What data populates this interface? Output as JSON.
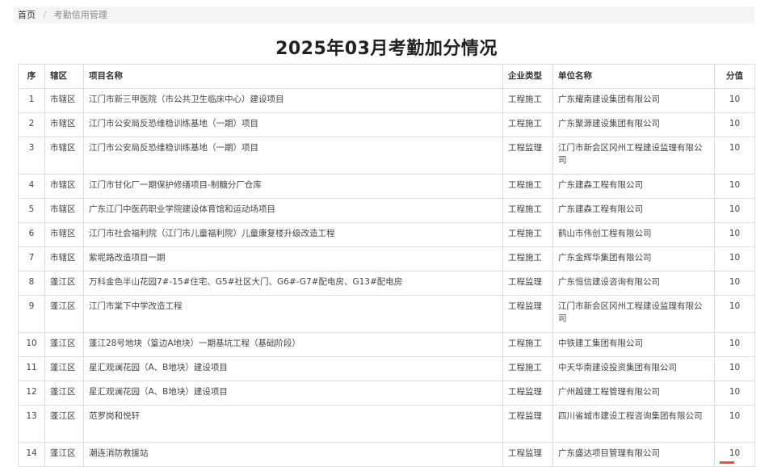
{
  "breadcrumb": {
    "home": "首页",
    "separator": "/",
    "current": "考勤信用管理"
  },
  "page_title": "2025年03月考勤加分情况",
  "table": {
    "headers": {
      "index": "序",
      "district": "辖区",
      "project": "项目名称",
      "type": "企业类型",
      "company": "单位名称",
      "score": "分值"
    },
    "rows": [
      {
        "index": "1",
        "district": "市辖区",
        "project": "江门市新三甲医院（市公共卫生临床中心）建设项目",
        "type": "工程施工",
        "company": "广东耀南建设集团有限公司",
        "score": "10"
      },
      {
        "index": "2",
        "district": "市辖区",
        "project": "江门市公安局反恐维稳训练基地（一期）项目",
        "type": "工程施工",
        "company": "广东聚源建设集团有限公司",
        "score": "10"
      },
      {
        "index": "3",
        "district": "市辖区",
        "project": "江门市公安局反恐维稳训练基地（一期）项目",
        "type": "工程监理",
        "company": "江门市新会区冈州工程建设监理有限公司",
        "score": "10"
      },
      {
        "index": "4",
        "district": "市辖区",
        "project": "江门市甘化厂一期保护修缮项目-制糖分厂仓库",
        "type": "工程施工",
        "company": "广东建森工程有限公司",
        "score": "10"
      },
      {
        "index": "5",
        "district": "市辖区",
        "project": "广东江门中医药职业学院建设体育馆和运动场项目",
        "type": "工程施工",
        "company": "广东建森工程有限公司",
        "score": "10"
      },
      {
        "index": "6",
        "district": "市辖区",
        "project": "江门市社会福利院（江门市儿童福利院）儿童康复楼升级改造工程",
        "type": "工程施工",
        "company": "鹤山市伟创工程有限公司",
        "score": "10"
      },
      {
        "index": "7",
        "district": "市辖区",
        "project": "紫坭路改造项目一期",
        "type": "工程施工",
        "company": "广东金辉华集团有限公司",
        "score": "10"
      },
      {
        "index": "8",
        "district": "蓬江区",
        "project": "万科金色半山花园7#-15#住宅、G5#社区大门、G6#-G7#配电房、G13#配电房",
        "type": "工程监理",
        "company": "广东恒信建设咨询有限公司",
        "score": "10"
      },
      {
        "index": "9",
        "district": "蓬江区",
        "project": "江门市棠下中学改造工程",
        "type": "工程监理",
        "company": "江门市新会区冈州工程建设监理有限公司",
        "score": "10"
      },
      {
        "index": "10",
        "district": "蓬江区",
        "project": "蓬江28号地块（篁边A地块）一期基坑工程（基础阶段）",
        "type": "工程施工",
        "company": "中铁建工集团有限公司",
        "score": "10"
      },
      {
        "index": "11",
        "district": "蓬江区",
        "project": "星汇观澜花园（A、B地块）建设项目",
        "type": "工程施工",
        "company": "中天华南建设投资集团有限公司",
        "score": "10"
      },
      {
        "index": "12",
        "district": "蓬江区",
        "project": "星汇观澜花园（A、B地块）建设项目",
        "type": "工程监理",
        "company": "广州越建工程管理有限公司",
        "score": "10"
      },
      {
        "index": "13",
        "district": "蓬江区",
        "project": "范罗岗和悦轩",
        "type": "工程监理",
        "company": "四川省城市建设工程咨询集团有限公司",
        "score": "10"
      },
      {
        "index": "14",
        "district": "蓬江区",
        "project": "潮连消防救援站",
        "type": "工程监理",
        "company": "广东盛达项目管理有限公司",
        "score": "10"
      }
    ]
  }
}
